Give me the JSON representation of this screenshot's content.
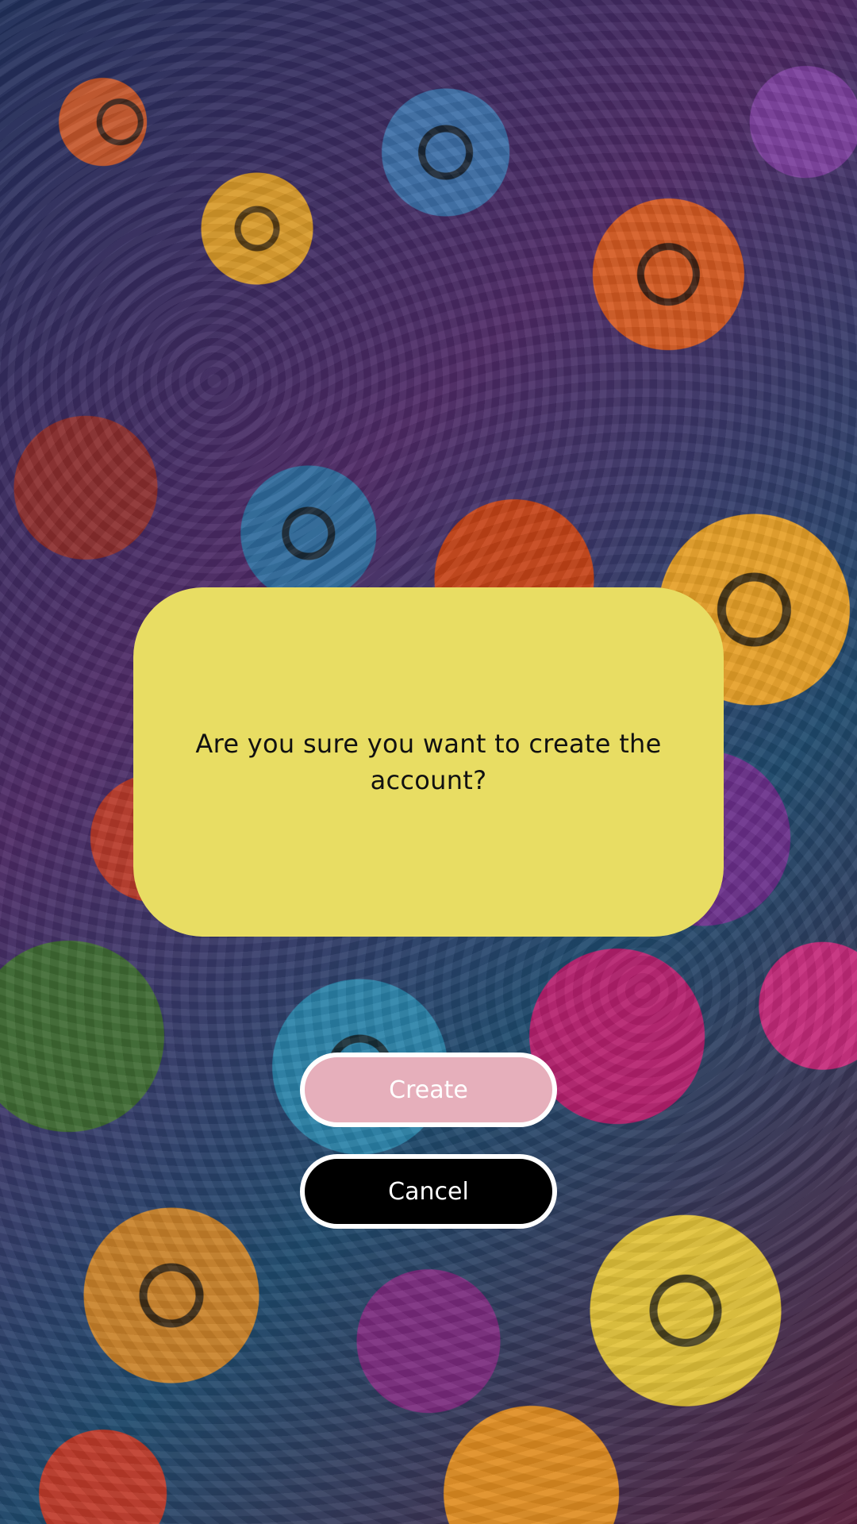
{
  "dialog": {
    "message": "Are you sure you want to create the account?"
  },
  "buttons": {
    "create_label": "Create",
    "cancel_label": "Cancel"
  },
  "colors": {
    "dialog_background": "#e8dd63",
    "create_button_background": "#e6afbb",
    "cancel_button_background": "#000000",
    "button_border": "#ffffff"
  }
}
